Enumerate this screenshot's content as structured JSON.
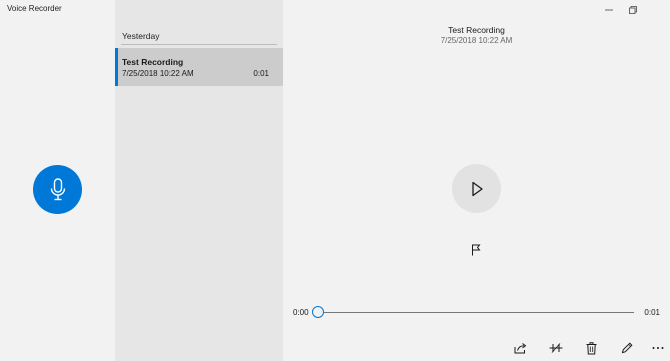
{
  "window": {
    "app_title": "Voice Recorder"
  },
  "list": {
    "group_header": "Yesterday",
    "items": [
      {
        "name": "Test Recording",
        "date": "7/25/2018 10:22 AM",
        "duration": "0:01",
        "selected": true
      }
    ]
  },
  "detail": {
    "title": "Test Recording",
    "date": "7/25/2018 10:22 AM",
    "current_time": "0:00",
    "total_time": "0:01",
    "progress": 0
  },
  "colors": {
    "accent": "#0078d7",
    "list_background": "#e6e6e6",
    "selected_item": "#cccccc",
    "app_background": "#f2f2f2"
  },
  "icons": {
    "record": "microphone-icon",
    "play": "play-icon",
    "marker": "flag-icon",
    "toolbar": [
      "share-icon",
      "trim-icon",
      "delete-icon",
      "rename-icon",
      "more-icon"
    ],
    "window": [
      "minimize-icon",
      "restore-icon"
    ]
  }
}
